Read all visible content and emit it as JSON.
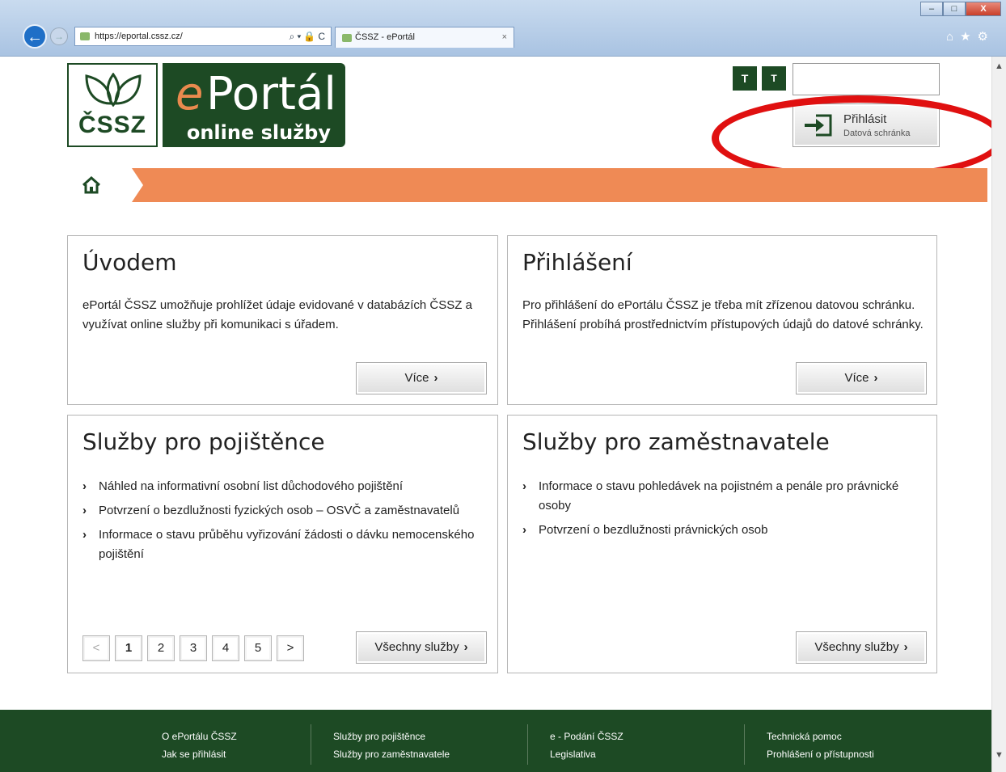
{
  "browser": {
    "url": "https://eportal.cssz.cz/",
    "tab_title": "ČSSZ - ePortál",
    "tab_close": "×",
    "addr_tools": "⌕▾🔒C",
    "win_min": "–",
    "win_max": "□",
    "win_close": "X",
    "icons": "⌂★⚙"
  },
  "header": {
    "logo_text": "ČSSZ",
    "brand_e": "e",
    "brand_portal": "Portál",
    "brand_sub": "online služby",
    "text_size_1": "T",
    "text_size_2": "T",
    "search_placeholder": "",
    "login": {
      "title": "Přihlásit",
      "subtitle": "Datová schránka"
    }
  },
  "cards": {
    "intro": {
      "title": "Úvodem",
      "text": "ePortál ČSSZ umožňuje prohlížet údaje evidované v databázích ČSSZ a využívat online služby při komunikaci s úřadem.",
      "button": "Více"
    },
    "login": {
      "title": "Přihlášení",
      "text": "Pro přihlášení do ePortálu ČSSZ je třeba mít zřízenou datovou schránku. Přihlášení probíhá prostřednictvím přístupových údajů do datové schránky.",
      "button": "Více"
    },
    "insured": {
      "title": "Služby pro pojištěnce",
      "items": [
        "Náhled na informativní osobní list důchodového pojištění",
        "Potvrzení o bezdlužnosti fyzických osob – OSVČ a zaměstnavatelů",
        "Informace o stavu průběhu vyřizování žádosti o dávku nemocenského pojištění"
      ],
      "pager": {
        "prev": "<",
        "pages": [
          "1",
          "2",
          "3",
          "4",
          "5"
        ],
        "next": ">"
      },
      "button": "Všechny služby"
    },
    "employers": {
      "title": "Služby pro zaměstnavatele",
      "items": [
        "Informace o stavu pohledávek na pojistném a penále pro právnické osoby",
        "Potvrzení o bezdlužnosti právnických osob"
      ],
      "button": "Všechny služby"
    }
  },
  "chevron": "›",
  "footer": {
    "col1": [
      "O ePortálu ČSSZ",
      "Jak se přihlásit"
    ],
    "col2": [
      "Služby pro pojištěnce",
      "Služby pro zaměstnavatele"
    ],
    "col3": [
      "e - Podání ČSSZ",
      "Legislativa"
    ],
    "col4": [
      "Technická pomoc",
      "Prohlášení o přístupnosti"
    ]
  }
}
